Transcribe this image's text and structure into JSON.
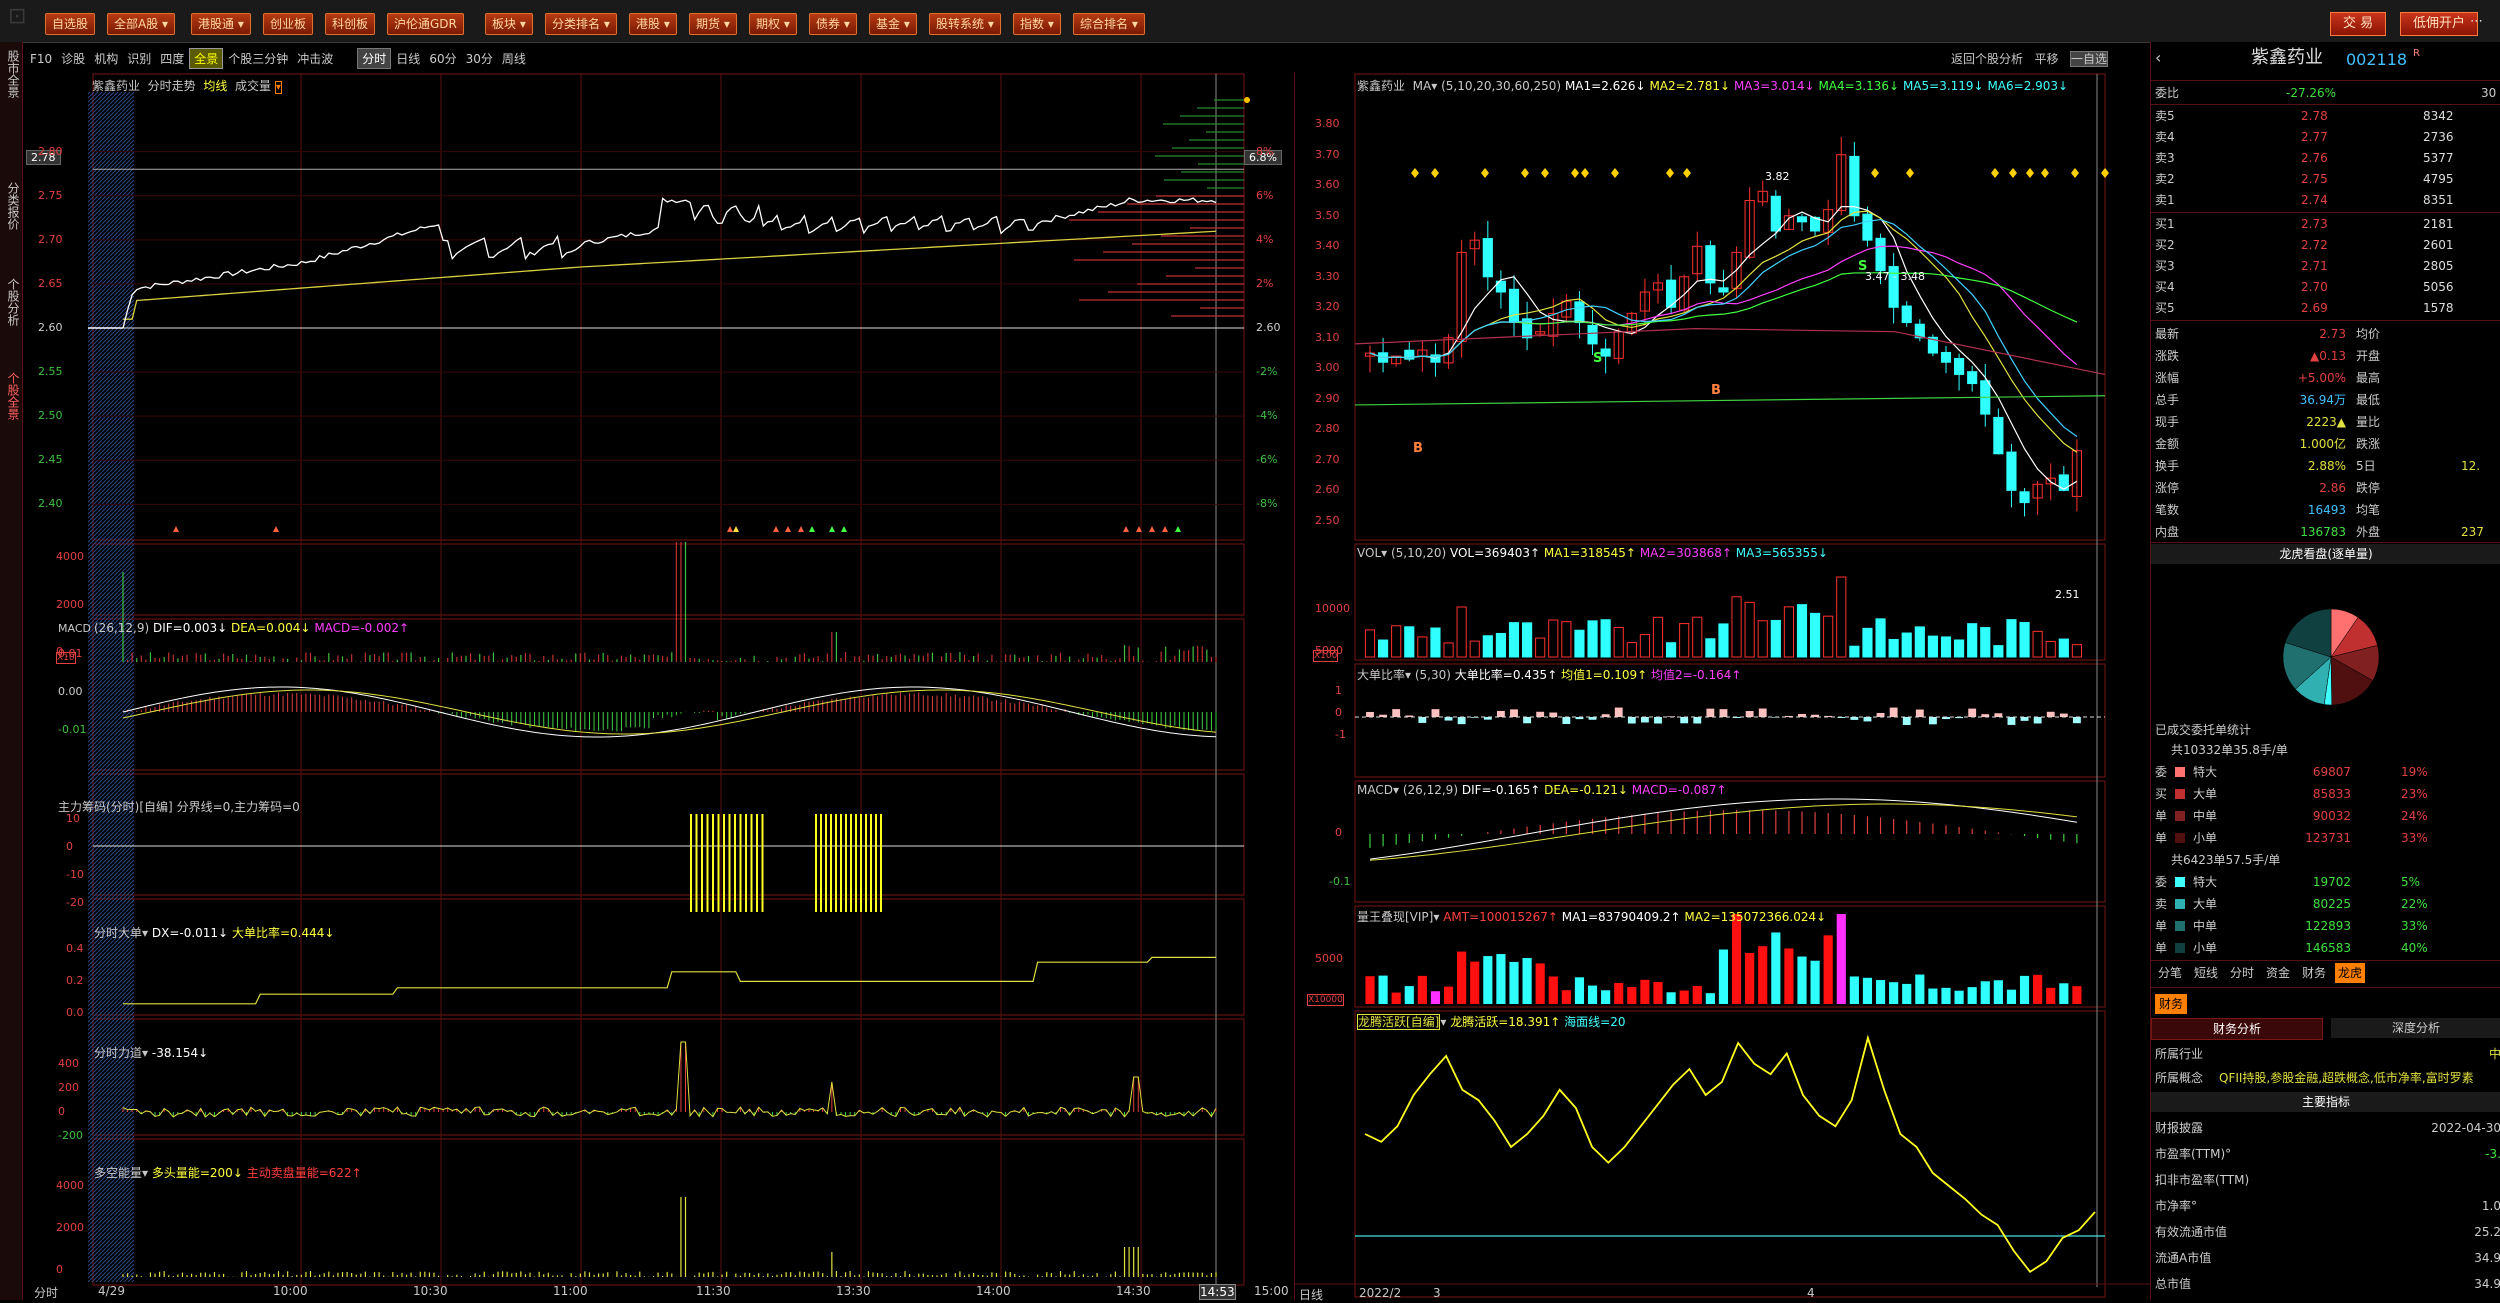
{
  "topbar": {
    "buttons": [
      "自选股",
      "全部A股",
      "港股通",
      "创业板",
      "科创板",
      "沪伦通GDR",
      "板块",
      "分类排名",
      "港股",
      "期货",
      "期权",
      "债券",
      "基金",
      "股转系统",
      "指数",
      "综合排名"
    ],
    "trade": "交 易",
    "open_account": "低佣开户"
  },
  "left_tabs": [
    "股市全景",
    "分类报价",
    "个股分析",
    "个股全景"
  ],
  "sub_toolbar": {
    "items": [
      "F10",
      "诊股",
      "机构",
      "识别",
      "四度",
      "全景",
      "个股三分钟",
      "冲击波",
      "分时",
      "日线",
      "60分",
      "30分",
      "周线"
    ]
  },
  "intraday": {
    "header": {
      "name": "紫鑫药业",
      "mode": "分时走势",
      "avg": "均线",
      "vol": "成交量"
    },
    "price_ticks": [
      "2.80",
      "2.75",
      "2.70",
      "2.65",
      "2.60",
      "2.55",
      "2.50",
      "2.45",
      "2.40"
    ],
    "pct_ticks": [
      "8%",
      "6%",
      "4%",
      "2%",
      "2.60",
      "-2%",
      "-4%",
      "-6%",
      "-8%"
    ],
    "current_price": "2.78",
    "current_pct": "6.8%",
    "vol_ticks": [
      "4000",
      "2000",
      "0"
    ],
    "vol_unit": "X10",
    "macd": {
      "label": "MACD",
      "params": "(26,12,9)",
      "dif": "DIF=0.003↓",
      "dea": "DEA=0.004↓",
      "macd": "MACD=-0.002↑",
      "ticks": [
        "0.01",
        "0.00",
        "-0.01"
      ]
    },
    "chip": {
      "label": "主力筹码(分时)",
      "own": "[自编]",
      "line": "分界线=0,主力筹码=0",
      "ticks": [
        "10",
        "0",
        "-10",
        "-20"
      ]
    },
    "bigorder": {
      "label": "分时大单",
      "dx": "DX=-0.011↓",
      "ratio": "大单比率=0.444↓",
      "ticks": [
        "0.4",
        "0.2",
        "0.0"
      ]
    },
    "force": {
      "label": "分时力道",
      "val": "-38.154↓",
      "ticks": [
        "400",
        "200",
        "0",
        "-200"
      ]
    },
    "energy": {
      "label": "多空能量",
      "long": "多头量能=200↓",
      "short": "主动卖盘量能=622↑",
      "ticks": [
        "4000",
        "2000",
        "0"
      ]
    },
    "xaxis": {
      "tab": "分时",
      "date": "4/29",
      "times": [
        "10:00",
        "10:30",
        "11:00",
        "11:30",
        "13:30",
        "14:00",
        "14:30",
        "14:53",
        "15:00"
      ]
    }
  },
  "kline": {
    "header": {
      "name": "紫鑫药业",
      "ma": "MA",
      "params": "(5,10,20,30,60,250)",
      "ma1": "MA1=2.626↓",
      "ma2": "MA2=2.781↓",
      "ma3": "MA3=3.014↓",
      "ma4": "MA4=3.136↓",
      "ma5": "MA5=3.119↓",
      "ma6": "MA6=2.903↓"
    },
    "right_menu": [
      "返回个股分析",
      "平移",
      "一自选"
    ],
    "price_ticks": [
      "3.80",
      "3.70",
      "3.60",
      "3.50",
      "3.40",
      "3.30",
      "3.20",
      "3.10",
      "3.00",
      "2.90",
      "2.80",
      "2.70",
      "2.60",
      "2.50"
    ],
    "annotations": {
      "high": "3.82",
      "range": "3.47 - 3.48",
      "low": "2.51"
    },
    "vol": {
      "label": "VOL",
      "params": "(5,10,20)",
      "vol": "VOL=369403↑",
      "ma1": "MA1=318545↑",
      "ma2": "MA2=303868↑",
      "ma3": "MA3=565355↓",
      "ticks": [
        "10000",
        "5000"
      ],
      "unit": "X100"
    },
    "bigratio": {
      "label": "大单比率",
      "params": "(5,30)",
      "v": "大单比率=0.435↑",
      "avg1": "均值1=0.109↑",
      "avg2": "均值2=-0.164↑",
      "ticks": [
        "1",
        "0",
        "-1"
      ]
    },
    "macd": {
      "label": "MACD",
      "params": "(26,12,9)",
      "dif": "DIF=-0.165↑",
      "dea": "DEA=-0.121↓",
      "macd": "MACD=-0.087↑",
      "ticks": [
        "0",
        "-0.1"
      ]
    },
    "amount": {
      "label": "量王叠现[VIP]",
      "amt": "AMT=100015267↑",
      "ma1": "MA1=83790409.2↑",
      "ma2": "MA2=135072366.024↓",
      "ticks": [
        "5000"
      ],
      "unit": "X10000"
    },
    "dragon": {
      "label": "龙腾活跃[自编]",
      "v": "龙腾活跃=18.391↑",
      "sea": "海面线=20"
    },
    "xaxis": {
      "tab": "日线",
      "labels": [
        "2022/2",
        "3",
        "4"
      ]
    }
  },
  "quote": {
    "name": "紫鑫药业",
    "code": "002118",
    "r": "R",
    "weibi_label": "委比",
    "weibi": "-27.26%",
    "weicha": "30",
    "sells": [
      [
        "卖5",
        "2.78",
        "8342"
      ],
      [
        "卖4",
        "2.77",
        "2736"
      ],
      [
        "卖3",
        "2.76",
        "5377"
      ],
      [
        "卖2",
        "2.75",
        "4795"
      ],
      [
        "卖1",
        "2.74",
        "8351"
      ]
    ],
    "buys": [
      [
        "买1",
        "2.73",
        "2181"
      ],
      [
        "买2",
        "2.72",
        "2601"
      ],
      [
        "买3",
        "2.71",
        "2805"
      ],
      [
        "买4",
        "2.70",
        "5056"
      ],
      [
        "买5",
        "2.69",
        "1578"
      ]
    ],
    "stats": [
      [
        "最新",
        "2.73",
        "均价",
        ""
      ],
      [
        "涨跌",
        "▲0.13",
        "开盘",
        ""
      ],
      [
        "涨幅",
        "+5.00%",
        "最高",
        ""
      ],
      [
        "总手",
        "36.94万",
        "最低",
        ""
      ],
      [
        "现手",
        "2223▲",
        "量比",
        ""
      ],
      [
        "金额",
        "1.000亿",
        "跌涨",
        ""
      ],
      [
        "换手",
        "2.88%",
        "5日",
        "12."
      ],
      [
        "涨停",
        "2.86",
        "跌停",
        ""
      ],
      [
        "笔数",
        "16493",
        "均笔",
        ""
      ],
      [
        "内盘",
        "136783",
        "外盘",
        "237"
      ]
    ],
    "pie_title": "龙虎看盘(逐单量)",
    "entrust_title": "已成交委托单统计",
    "buy_summary": "共10332单35.8手/单",
    "buy_rows": [
      [
        "特大",
        "69807",
        "19%"
      ],
      [
        "大单",
        "85833",
        "23%"
      ],
      [
        "中单",
        "90032",
        "24%"
      ],
      [
        "小单",
        "123731",
        "33%"
      ]
    ],
    "buy_side": [
      "委",
      "买",
      "单"
    ],
    "sell_summary": "共6423单57.5手/单",
    "sell_rows": [
      [
        "特大",
        "19702",
        "5%"
      ],
      [
        "大单",
        "80225",
        "22%"
      ],
      [
        "中单",
        "122893",
        "33%"
      ],
      [
        "小单",
        "146583",
        "40%"
      ]
    ],
    "sell_side": [
      "委",
      "卖",
      "单"
    ],
    "tabs": [
      "分笔",
      "短线",
      "分时",
      "资金",
      "财务",
      "龙虎"
    ],
    "fin_tab": "财务",
    "fin_sub": [
      "财务分析",
      "深度分析"
    ],
    "industry_label": "所属行业",
    "industry_val": "中",
    "concept_label": "所属概念",
    "concept_val": "QFII持股,参股金融,超跌概念,低市净率,富时罗素",
    "main_title": "主要指标",
    "fin_rows": [
      [
        "财报披露",
        "2022-04-30"
      ],
      [
        "市盈率(TTM)°",
        "-3."
      ],
      [
        "扣非市盈率(TTM)",
        ""
      ],
      [
        "市净率°",
        "1.0"
      ],
      [
        "有效流通市值",
        "25.2"
      ],
      [
        "流通A市值",
        "34.9"
      ],
      [
        "总市值",
        "34.9"
      ]
    ]
  }
}
